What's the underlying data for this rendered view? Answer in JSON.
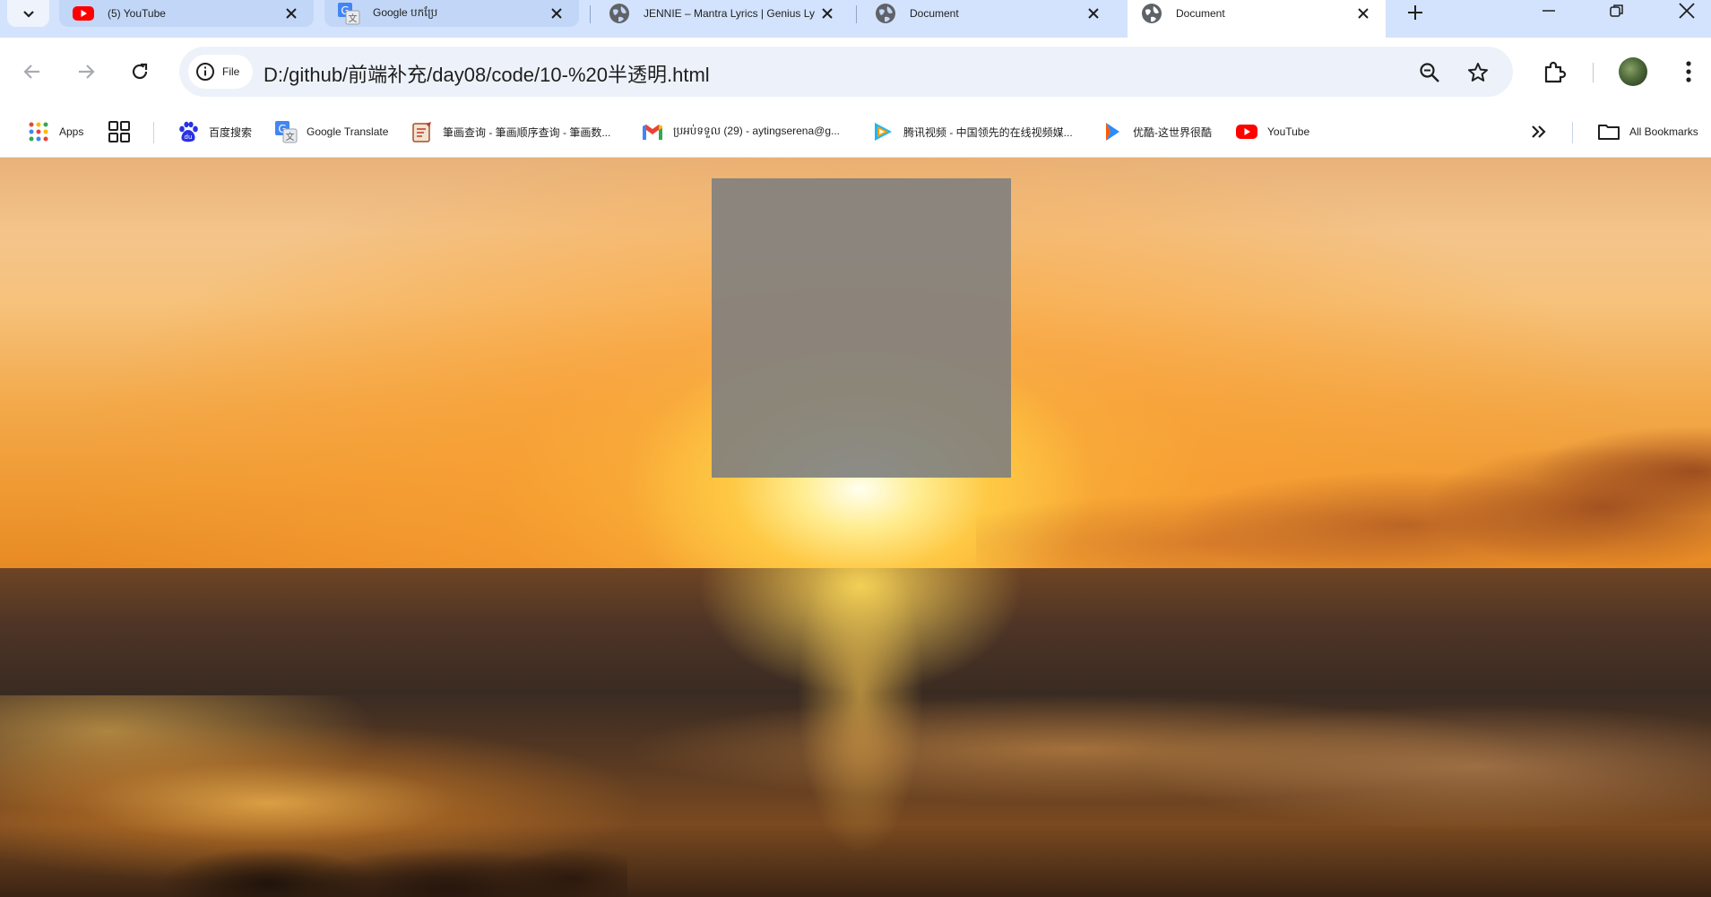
{
  "tabs": [
    {
      "title": "(5) YouTube",
      "icon": "youtube-icon"
    },
    {
      "title": "Google បកប្រែ",
      "icon": "google-translate-icon"
    },
    {
      "title": "JENNIE – Mantra Lyrics | Genius Ly",
      "icon": "globe-icon"
    },
    {
      "title": "Document",
      "icon": "globe-icon"
    },
    {
      "title": "Document",
      "icon": "globe-icon",
      "active": true
    }
  ],
  "toolbar": {
    "site_chip_label": "File",
    "url": "D:/github/前端补充/day08/code/10-%20半透明.html"
  },
  "bookmarks": {
    "items": [
      {
        "label": "Apps",
        "icon": "apps-grid-icon"
      },
      {
        "label": "",
        "icon": "tab-groups-icon"
      },
      {
        "label": "百度搜索",
        "icon": "baidu-icon"
      },
      {
        "label": "Google Translate",
        "icon": "google-translate-icon"
      },
      {
        "label": "筆画查询 - 筆画顺序查询 - 筆画数...",
        "icon": "stroke-order-icon"
      },
      {
        "label": "ប្រអប់ទទួល (29) - aytingserena@g...",
        "icon": "gmail-icon"
      },
      {
        "label": "腾讯视频 - 中国领先的在线视频媒...",
        "icon": "tencent-video-icon"
      },
      {
        "label": "优酷-这世界很酷",
        "icon": "youku-icon"
      },
      {
        "label": "YouTube",
        "icon": "youtube-icon"
      }
    ],
    "all_bookmarks_label": "All Bookmarks"
  },
  "page": {
    "box_color": "#808080",
    "box_opacity": 0.9
  },
  "colors": {
    "tabstrip_bg": "#d3e3fd",
    "omnibox_bg": "#edf2fa"
  }
}
